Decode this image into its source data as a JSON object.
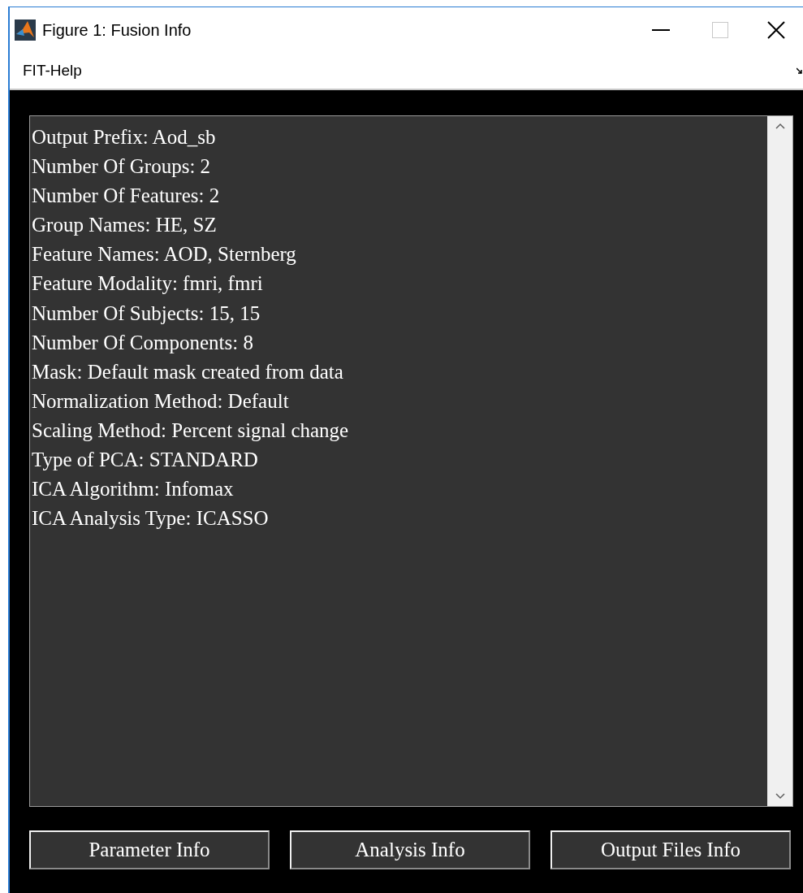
{
  "window": {
    "title": "Figure 1: Fusion Info"
  },
  "menu": [
    "FIT-Help"
  ],
  "info_lines": [
    "Output Prefix: Aod_sb",
    "Number Of Groups: 2",
    "Number Of Features: 2",
    "Group Names: HE, SZ",
    "Feature Names: AOD, Sternberg",
    "Feature Modality: fmri, fmri",
    "Number Of Subjects: 15, 15",
    "Number Of Components: 8",
    "Mask: Default mask created from data",
    "Normalization Method: Default",
    "Scaling Method: Percent signal change",
    "Type of PCA: STANDARD",
    "ICA Algorithm: Infomax",
    "ICA Analysis Type: ICASSO"
  ],
  "buttons": [
    "Parameter Info",
    "Analysis Info",
    "Output Files Info"
  ]
}
